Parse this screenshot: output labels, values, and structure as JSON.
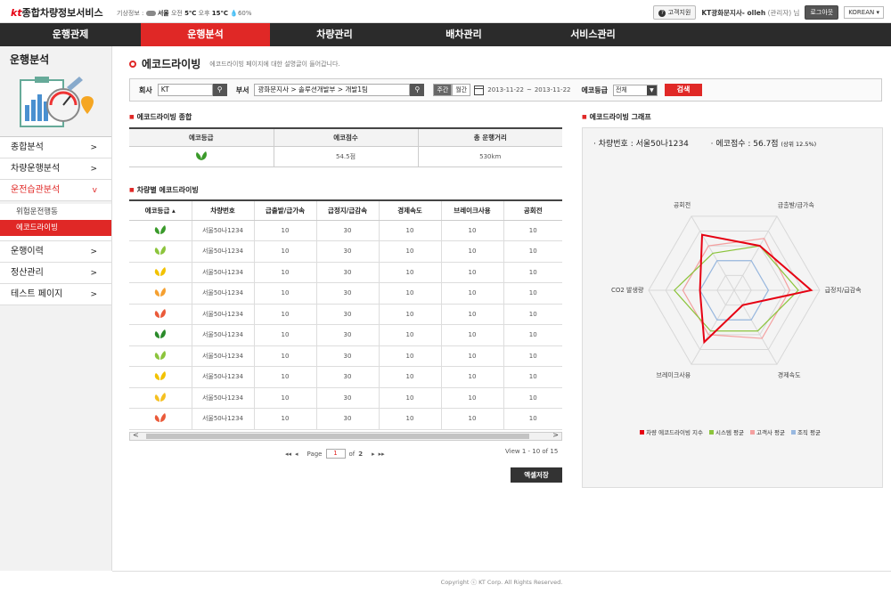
{
  "header": {
    "logo_kt": "kt",
    "logo_text": "종합차량정보서비스",
    "weather_label": "기상정보 :",
    "weather_city": "서울",
    "am_label": "오전",
    "am_temp": "5℃",
    "pm_label": "오후",
    "pm_temp": "15℃",
    "humidity": "60%",
    "support": "고객지원",
    "user": "KT광화문지사- olleh",
    "user_role": "(관리자) 님",
    "logout": "로그아웃",
    "language": "KOREAN"
  },
  "nav": [
    "운행관제",
    "운행분석",
    "차량관리",
    "배차관리",
    "서비스관리"
  ],
  "sidebar": {
    "title": "운행분석",
    "items": [
      {
        "label": "종합분석"
      },
      {
        "label": "차량운행분석"
      },
      {
        "label": "운전습관분석"
      },
      {
        "label": "운행이력"
      },
      {
        "label": "정산관리"
      },
      {
        "label": "테스트 페이지"
      }
    ],
    "subitems": [
      "위험운전행동",
      "에코드라이빙"
    ]
  },
  "page": {
    "title": "에코드라이빙",
    "description": "에코드라이빙 페이지에 대한 설명글이 들어갑니다."
  },
  "search": {
    "company_label": "회사",
    "company_value": "KT",
    "dept_label": "부서",
    "dept_value": "광화문지사 > 솔루션개발부 > 개발1팀",
    "week": "주간",
    "month": "월간",
    "date_from": "2013-11-22",
    "date_sep": "~",
    "date_to": "2013-11-22",
    "grade_label": "에코등급",
    "grade_value": "전체",
    "search_btn": "검색"
  },
  "summary": {
    "heading": "에코드라이빙 종합",
    "columns": [
      "에코등급",
      "에코점수",
      "총 운행거리"
    ],
    "score": "54.5점",
    "distance": "530km"
  },
  "vehicles": {
    "heading": "차량별 에코드라이빙",
    "columns": [
      "에코등급 ▴",
      "차량번호",
      "급출발/급가속",
      "급정지/급감속",
      "경제속도",
      "브레이크사용",
      "공회전"
    ],
    "rows": [
      {
        "grade": "#3a9a2a",
        "number": "서울50나1234",
        "v1": "10",
        "v2": "30",
        "v3": "10",
        "v4": "10",
        "v5": "10"
      },
      {
        "grade": "#8cc43c",
        "number": "서울50나1234",
        "v1": "10",
        "v2": "30",
        "v3": "10",
        "v4": "10",
        "v5": "10"
      },
      {
        "grade": "#f2c200",
        "number": "서울50나1234",
        "v1": "10",
        "v2": "30",
        "v3": "10",
        "v4": "10",
        "v5": "10"
      },
      {
        "grade": "#f5a030",
        "number": "서울50나1234",
        "v1": "10",
        "v2": "30",
        "v3": "10",
        "v4": "10",
        "v5": "10"
      },
      {
        "grade": "#ea5a3a",
        "number": "서울50나1234",
        "v1": "10",
        "v2": "30",
        "v3": "10",
        "v4": "10",
        "v5": "10"
      },
      {
        "grade": "#2a8a2a",
        "number": "서울50나1234",
        "v1": "10",
        "v2": "30",
        "v3": "10",
        "v4": "10",
        "v5": "10"
      },
      {
        "grade": "#8cc43c",
        "number": "서울50나1234",
        "v1": "10",
        "v2": "30",
        "v3": "10",
        "v4": "10",
        "v5": "10"
      },
      {
        "grade": "#f2c200",
        "number": "서울50나1234",
        "v1": "10",
        "v2": "30",
        "v3": "10",
        "v4": "10",
        "v5": "10"
      },
      {
        "grade": "#f5c020",
        "number": "서울50나1234",
        "v1": "10",
        "v2": "30",
        "v3": "10",
        "v4": "10",
        "v5": "10"
      },
      {
        "grade": "#ea5a3a",
        "number": "서울50나1234",
        "v1": "10",
        "v2": "30",
        "v3": "10",
        "v4": "10",
        "v5": "10"
      }
    ],
    "pager_page_label": "Page",
    "pager_page": "1",
    "pager_of": "of",
    "pager_total": "2",
    "view_count": "View 1 - 10 of 15",
    "excel": "엑셀저장"
  },
  "graph": {
    "heading": "에코드라이빙 그래프",
    "vehicle_label": "· 차량번호 : 서울50나1234",
    "score_label": "· 에코점수 : 56.7점",
    "rank_label": "(상위 12.5%)"
  },
  "chart_data": {
    "type": "radar",
    "categories": [
      "급출발/급가속",
      "급정지/급감속",
      "경제속도",
      "브레이크사용",
      "CO2 발생량",
      "공회전"
    ],
    "max": 100,
    "series": [
      {
        "name": "차량 에코드라이빙 지수",
        "color": "#e60012",
        "values": [
          60,
          90,
          20,
          70,
          40,
          75
        ]
      },
      {
        "name": "시스템 평균",
        "color": "#8cc43c",
        "values": [
          60,
          75,
          55,
          55,
          70,
          50
        ]
      },
      {
        "name": "고객사 평균",
        "color": "#f4a0a0",
        "values": [
          70,
          65,
          65,
          60,
          60,
          60
        ]
      },
      {
        "name": "조직 평균",
        "color": "#98b8e0",
        "values": [
          40,
          40,
          40,
          40,
          40,
          40
        ]
      }
    ]
  },
  "footer": "Copyright ⓒ KT Corp. All Rights Reserved."
}
